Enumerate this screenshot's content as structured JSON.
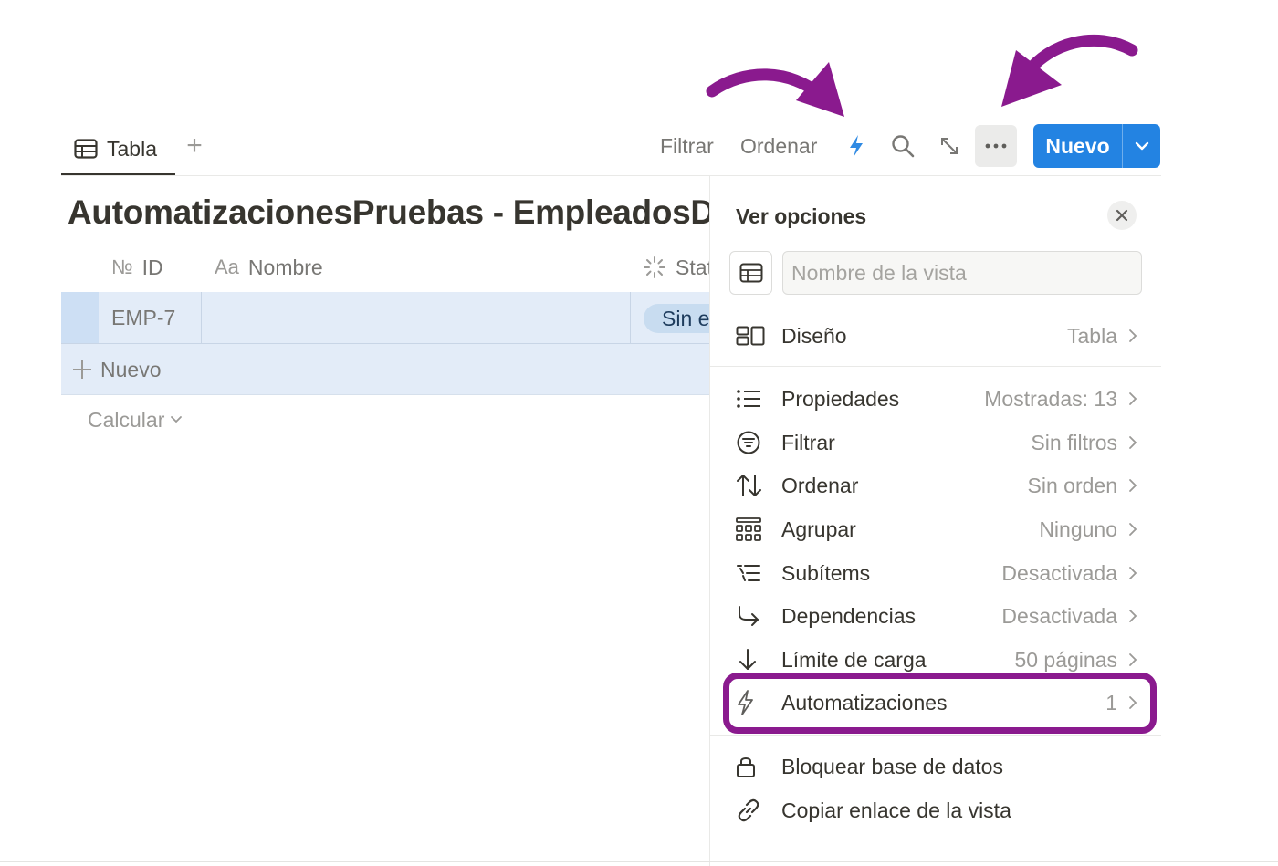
{
  "views": {
    "active_tab_label": "Tabla",
    "add_view_symbol": "+"
  },
  "toolbar": {
    "filter_label": "Filtrar",
    "sort_label": "Ordenar",
    "new_label": "Nuevo",
    "icons": [
      "lightning-icon",
      "search-icon",
      "expand-icon",
      "more-icon",
      "chevron-down-icon"
    ],
    "accent_color": "#2383e2"
  },
  "database": {
    "title": "AutomatizacionesPruebas - EmpleadosDatos",
    "columns": [
      {
        "prefix": "№",
        "label": "ID"
      },
      {
        "prefix": "Aa",
        "label": "Nombre"
      },
      {
        "prefix": "",
        "label": "Status"
      }
    ],
    "rows": [
      {
        "id": "EMP-7",
        "nombre": "",
        "status": "Sin empezar"
      }
    ],
    "add_row_label": "Nuevo",
    "calculate_label": "Calcular"
  },
  "panel": {
    "title": "Ver opciones",
    "view_name_placeholder": "Nombre de la vista",
    "layout": {
      "label": "Diseño",
      "value": "Tabla"
    },
    "options": [
      {
        "label": "Propiedades",
        "value": "Mostradas: 13",
        "icon": "list-icon"
      },
      {
        "label": "Filtrar",
        "value": "Sin filtros",
        "icon": "filter-icon"
      },
      {
        "label": "Ordenar",
        "value": "Sin orden",
        "icon": "sort-icon"
      },
      {
        "label": "Agrupar",
        "value": "Ninguno",
        "icon": "group-icon"
      },
      {
        "label": "Subítems",
        "value": "Desactivada",
        "icon": "subitems-icon"
      },
      {
        "label": "Dependencias",
        "value": "Desactivada",
        "icon": "dependencies-icon"
      },
      {
        "label": "Límite de carga",
        "value": "50 páginas",
        "icon": "arrow-down-icon"
      },
      {
        "label": "Automatizaciones",
        "value": "1",
        "icon": "lightning-icon"
      }
    ],
    "actions": [
      {
        "label": "Bloquear base de datos",
        "icon": "lock-icon"
      },
      {
        "label": "Copiar enlace de la vista",
        "icon": "link-icon"
      }
    ]
  },
  "annotations": {
    "arrow_color": "#8a1a8e",
    "highlight_color": "#8a1a8e"
  }
}
